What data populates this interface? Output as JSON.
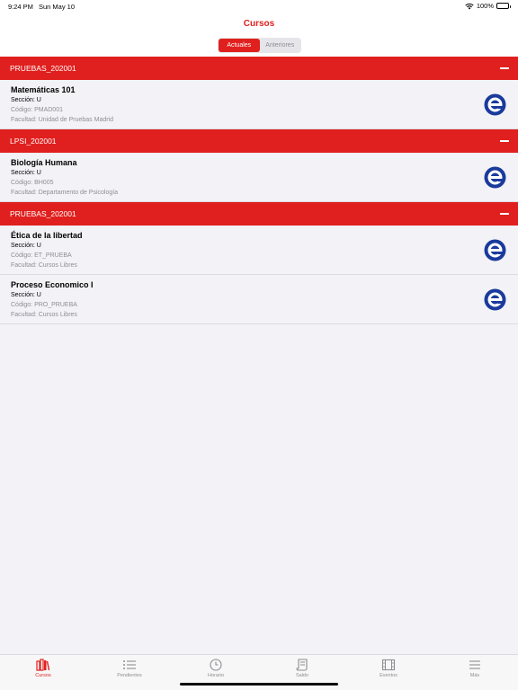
{
  "status": {
    "time": "9:24 PM",
    "date": "Sun May 10",
    "battery": "100%",
    "battery_level": 1.0
  },
  "header": {
    "title": "Cursos",
    "segments": [
      {
        "label": "Actuales",
        "active": true
      },
      {
        "label": "Anteriores",
        "active": false
      }
    ]
  },
  "accent_color": "#e0201e",
  "logo_color": "#1a3a9c",
  "groups": [
    {
      "title": "PRUEBAS_202001",
      "courses": [
        {
          "name": "Matemáticas 101",
          "section": "Sección: U",
          "code": "Código: PMAD001",
          "faculty": "Facultad: Unidad de Pruebas Madrid",
          "icon": "e-logo-icon"
        }
      ]
    },
    {
      "title": "LPSI_202001",
      "courses": [
        {
          "name": "Biología Humana",
          "section": "Sección: U",
          "code": "Código: BH005",
          "faculty": "Facultad: Departamento de Psicología",
          "icon": "e-logo-icon"
        }
      ]
    },
    {
      "title": "PRUEBAS_202001",
      "courses": [
        {
          "name": "Ética de la libertad",
          "section": "Sección: U",
          "code": "Código: ET_PRUEBA",
          "faculty": "Facultad: Cursos Libres",
          "icon": "e-logo-icon"
        },
        {
          "name": "Proceso Economico I",
          "section": "Sección: U",
          "code": "Código: PRO_PRUEBA",
          "faculty": "Facultad: Cursos Libres",
          "icon": "e-logo-icon"
        }
      ]
    }
  ],
  "tabs": [
    {
      "label": "Cursos",
      "icon": "books-icon",
      "active": true
    },
    {
      "label": "Pendientes",
      "icon": "list-icon",
      "active": false
    },
    {
      "label": "Horario",
      "icon": "clock-icon",
      "active": false
    },
    {
      "label": "Saldo",
      "icon": "receipt-icon",
      "active": false
    },
    {
      "label": "Eventos",
      "icon": "film-icon",
      "active": false
    },
    {
      "label": "Más",
      "icon": "menu-icon",
      "active": false
    }
  ]
}
